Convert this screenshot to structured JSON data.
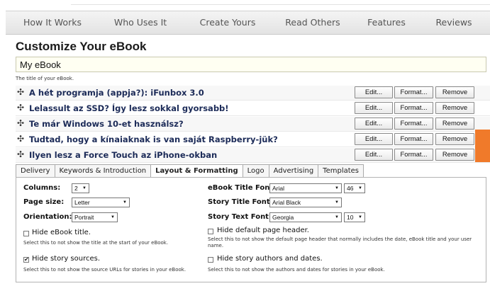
{
  "nav": {
    "items": [
      "How It Works",
      "Who Uses It",
      "Create Yours",
      "Read Others",
      "Features",
      "Reviews"
    ]
  },
  "page": {
    "title": "Customize Your eBook",
    "ebook_title_value": "My eBook",
    "ebook_title_hint": "The title of your eBook."
  },
  "stories": [
    {
      "title": "A hét programja (appja?): iFunbox 3.0"
    },
    {
      "title": "Lelassult az SSD? Így lesz sokkal gyorsabb!"
    },
    {
      "title": "Te már Windows 10-et használsz?"
    },
    {
      "title": "Tudtad, hogy a kínaiaknak is van saját Raspberry-jük?"
    },
    {
      "title": "Ilyen lesz a Force Touch az iPhone-okban"
    }
  ],
  "story_buttons": {
    "edit": "Edit...",
    "format": "Format...",
    "remove": "Remove"
  },
  "tabs": [
    "Delivery",
    "Keywords & Introduction",
    "Layout & Formatting",
    "Logo",
    "Advertising",
    "Templates"
  ],
  "active_tab": "Layout & Formatting",
  "layout": {
    "columns_label": "Columns:",
    "columns_value": "2",
    "page_size_label": "Page size:",
    "page_size_value": "Letter",
    "orientation_label": "Orientation:",
    "orientation_value": "Portrait",
    "ebook_title_font_label": "eBook Title Font:",
    "ebook_title_font_value": "Arial",
    "ebook_title_font_size": "46",
    "story_title_font_label": "Story Title Font:",
    "story_title_font_value": "Arial Black",
    "story_text_font_label": "Story Text Font:",
    "story_text_font_value": "Georgia",
    "story_text_font_size": "10",
    "hide_ebook_title_label": "Hide eBook title.",
    "hide_ebook_title_checked": false,
    "hide_ebook_title_desc": "Select this to not show the title at the start of your eBook.",
    "hide_default_header_label": "Hide default page header.",
    "hide_default_header_checked": false,
    "hide_default_header_desc": "Select this to not show the default page header that normally includes the date, eBook title and your user name.",
    "hide_story_sources_label": "Hide story sources.",
    "hide_story_sources_checked": true,
    "hide_story_sources_desc": "Select this to not show the source URLs for stories in your eBook.",
    "hide_story_authors_label": "Hide story authors and dates.",
    "hide_story_authors_checked": false,
    "hide_story_authors_desc": "Select this to not show the authors and dates for stories in your eBook."
  },
  "colors": {
    "accent_orange": "#f07a2a",
    "story_title": "#1c2b58",
    "input_bg": "#fffff2"
  }
}
